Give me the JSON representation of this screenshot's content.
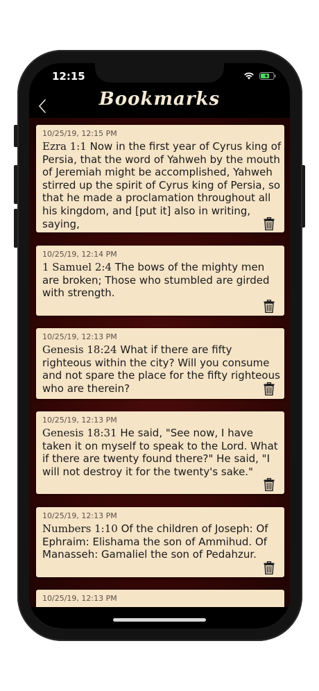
{
  "status": {
    "time": "12:15"
  },
  "nav": {
    "title": "Bookmarks"
  },
  "bookmarks": [
    {
      "date": "10/25/19, 12:15 PM",
      "ref": "Ezra 1:1",
      "text": " Now in the first year of Cyrus king of Persia, that the word of Yahweh by the mouth of Jeremiah might be accomplished, Yahweh stirred up the spirit of Cyrus king of Persia, so that he made a proclamation throughout all his kingdom, and [put it] also in writing, saying,"
    },
    {
      "date": "10/25/19, 12:14 PM",
      "ref": "1 Samuel 2:4",
      "text": " The bows of the mighty men are broken; Those who stumbled are girded with strength."
    },
    {
      "date": "10/25/19, 12:13 PM",
      "ref": "Genesis 18:24",
      "text": " What if there are fifty righteous within the city? Will you consume and not spare the place for the fifty righteous who are therein?"
    },
    {
      "date": "10/25/19, 12:13 PM",
      "ref": "Genesis 18:31",
      "text": " He said, \"See now, I have taken it on myself to speak to the Lord. What if there are twenty found there?\" He said, \"I will not destroy it for the twenty's sake.\""
    },
    {
      "date": "10/25/19, 12:13 PM",
      "ref": "Numbers 1:10",
      "text": " Of the children of Joseph: Of Ephraim: Elishama the son of Ammihud. Of Manasseh: Gamaliel the son of Pedahzur."
    },
    {
      "date": "10/25/19, 12:13 PM",
      "ref": "",
      "text": ""
    }
  ]
}
